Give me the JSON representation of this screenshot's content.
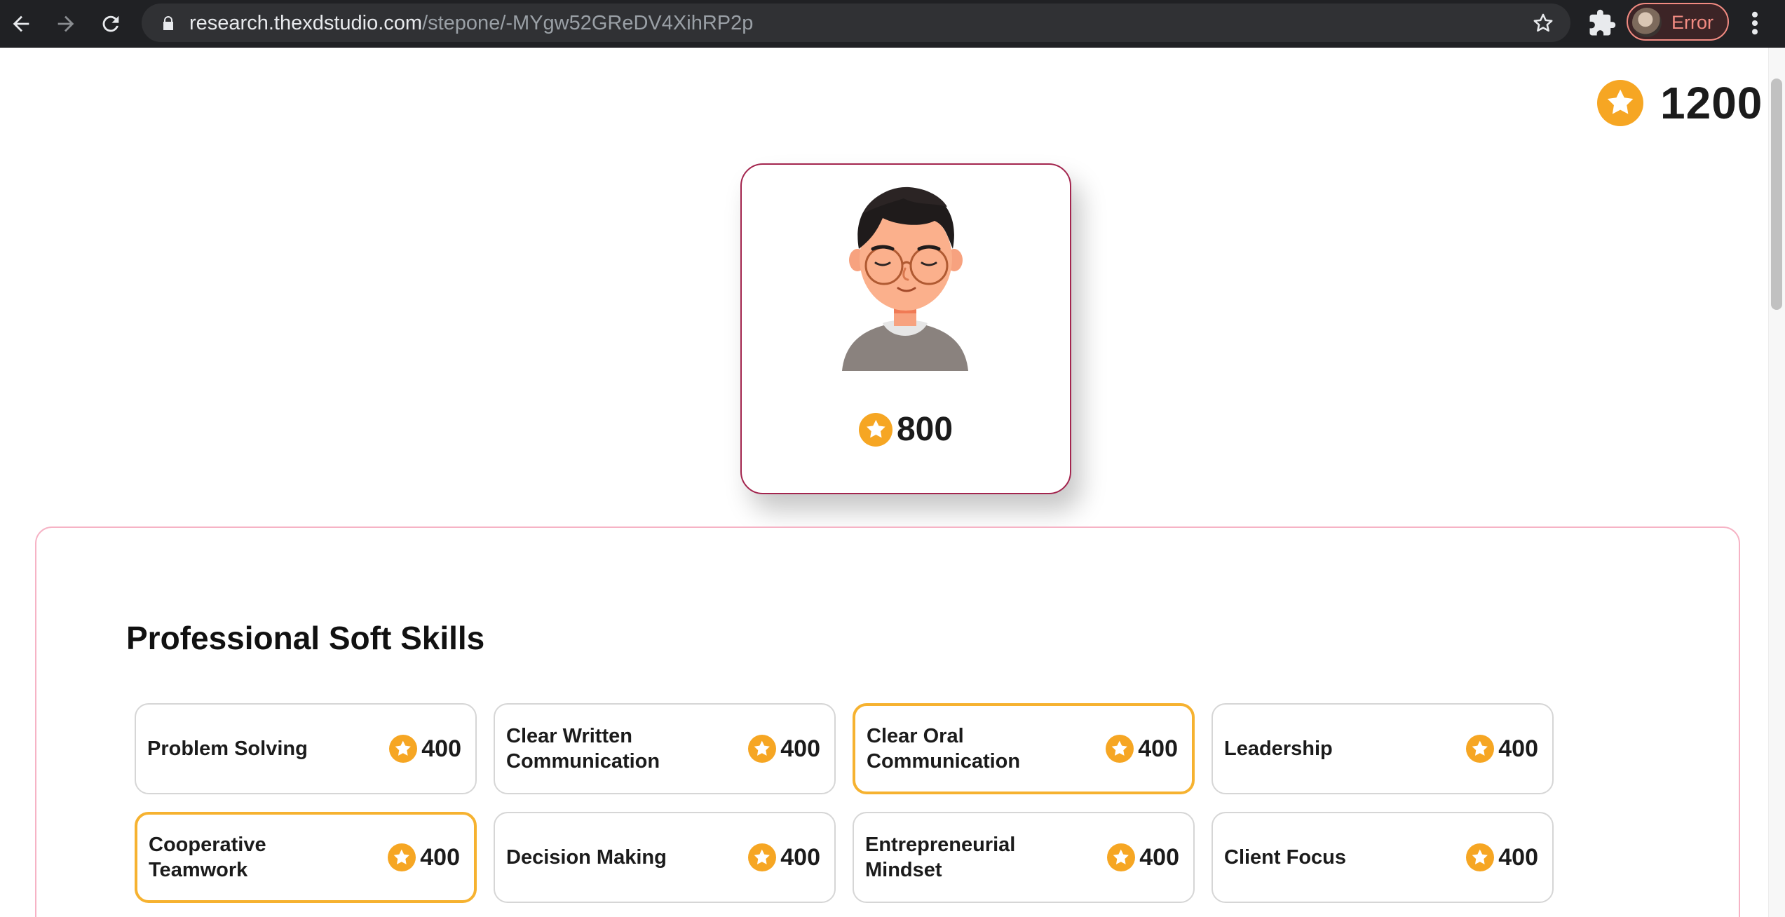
{
  "browser": {
    "url_host": "research.thexdstudio.com",
    "url_path": "/stepone/-MYgw52GReDV4XihRP2p",
    "profile_status": "Error"
  },
  "score": {
    "total": "1200"
  },
  "profile": {
    "points": "800"
  },
  "skills": {
    "title": "Professional Soft Skills",
    "items": [
      {
        "name": "Problem Solving",
        "points": "400",
        "selected": false
      },
      {
        "name": "Clear Written Communication",
        "points": "400",
        "selected": false
      },
      {
        "name": "Clear Oral Communication",
        "points": "400",
        "selected": true
      },
      {
        "name": "Leadership",
        "points": "400",
        "selected": false
      },
      {
        "name": "Cooperative Teamwork",
        "points": "400",
        "selected": true
      },
      {
        "name": "Decision Making",
        "points": "400",
        "selected": false
      },
      {
        "name": "Entrepreneurial Mindset",
        "points": "400",
        "selected": false
      },
      {
        "name": "Client Focus",
        "points": "400",
        "selected": false
      }
    ]
  },
  "colors": {
    "coin": "#f6a623",
    "card_border": "#a3254e",
    "selected_border": "#f6b230",
    "panel_border": "#f6b3c5"
  },
  "icons": [
    "back-arrow-icon",
    "forward-arrow-icon",
    "reload-icon",
    "lock-icon",
    "bookmark-star-icon",
    "extensions-puzzle-icon",
    "kebab-menu-icon",
    "star-coin-icon"
  ]
}
